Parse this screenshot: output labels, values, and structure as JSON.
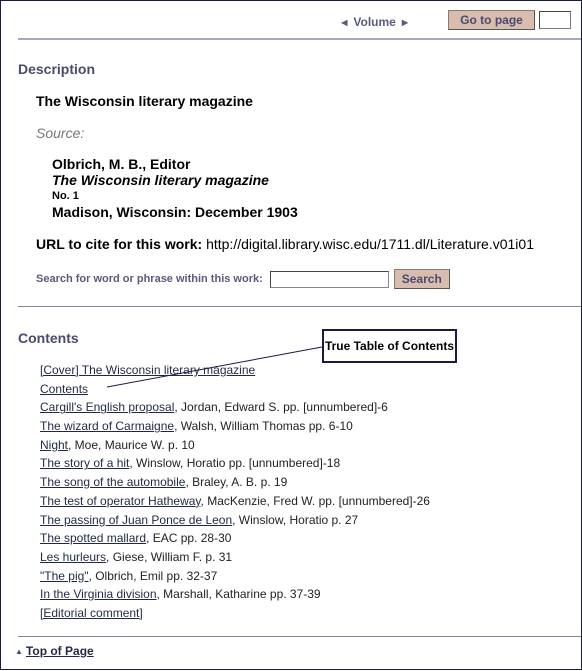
{
  "nav": {
    "prev_icon": "triangle-left-icon",
    "volume_label": "Volume",
    "next_icon": "triangle-right-icon",
    "goto_label": "Go to page",
    "goto_value": ""
  },
  "description": {
    "heading": "Description",
    "title": "The Wisconsin literary magazine",
    "source_label": "Source:",
    "source": {
      "editor": "Olbrich, M. B., Editor",
      "publication": "The Wisconsin literary magazine",
      "issue": "No. 1",
      "place_date": "Madison, Wisconsin: December 1903"
    },
    "cite_label": "URL to cite for this work:",
    "cite_url": "http://digital.library.wisc.edu/1711.dl/Literature.v01i01",
    "search_label": "Search for word or phrase within this work:",
    "search_value": "",
    "search_button": "Search"
  },
  "contents": {
    "heading": "Contents",
    "items": [
      {
        "link": "[Cover] The Wisconsin literary magazine",
        "rest": ""
      },
      {
        "link": "Contents",
        "rest": ""
      },
      {
        "link": "Cargill's English proposal",
        "rest": ", Jordan, Edward S. pp. [unnumbered]-6"
      },
      {
        "link": "The wizard of Carmaigne",
        "rest": ", Walsh, William Thomas pp. 6-10"
      },
      {
        "link": "Night",
        "rest": ", Moe, Maurice W. p. 10"
      },
      {
        "link": "The story of a hit",
        "rest": ", Winslow, Horatio pp. [unnumbered]-18"
      },
      {
        "link": "The song of the automobile",
        "rest": ", Braley, A. B. p. 19"
      },
      {
        "link": "The test of operator Hatheway",
        "rest": ", MacKenzie, Fred W. pp. [unnumbered]-26"
      },
      {
        "link": "The passing of Juan Ponce de Leon",
        "rest": ", Winslow, Horatio p. 27"
      },
      {
        "link": "The spotted mallard",
        "rest": ", EAC pp. 28-30"
      },
      {
        "link": "Les hurleurs",
        "rest": ", Giese, William F. p. 31"
      },
      {
        "link": "\"The pig\"",
        "rest": ", Olbrich, Emil pp. 32-37"
      },
      {
        "link": "In the Virginia division",
        "rest": ", Marshall, Katharine pp. 37-39"
      },
      {
        "link": "[Editorial comment]",
        "rest": ""
      }
    ]
  },
  "annotation": {
    "callout_text": "True Table of Contents"
  },
  "footer": {
    "top_icon": "triangle-up-icon",
    "top_link": "Top of Page"
  }
}
